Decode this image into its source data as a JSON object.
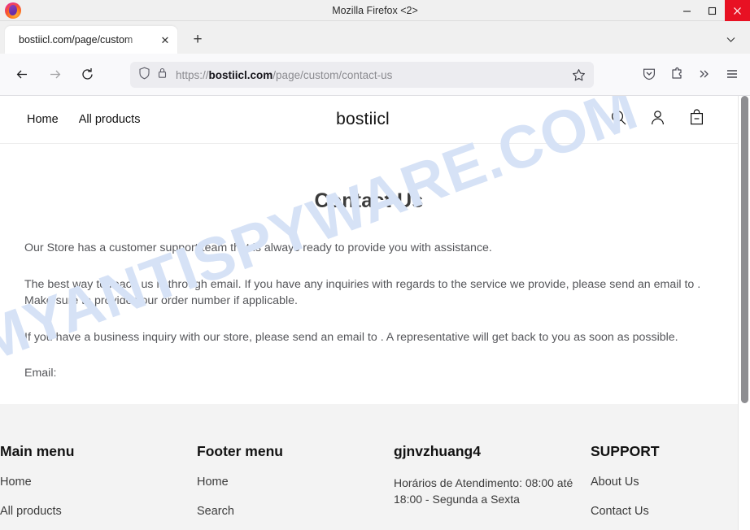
{
  "window": {
    "title": "Mozilla Firefox <2>",
    "controls": {
      "minimize": "minimize-icon",
      "maximize": "maximize-icon",
      "close": "close-icon"
    },
    "logo": "firefox-logo"
  },
  "tabs": {
    "items": [
      {
        "title": "bostiicl.com/page/custom",
        "close_label": "✕"
      }
    ],
    "new_tab_label": "+",
    "list_all_tabs": "chevron-down-icon"
  },
  "toolbar": {
    "back": "back-arrow-icon",
    "forward": "forward-arrow-icon",
    "reload": "reload-icon",
    "shield": "shield-icon",
    "lock": "lock-icon",
    "url_scheme": "https://",
    "url_host": "bostiicl.com",
    "url_path": "/page/custom/contact-us",
    "url_full": "https://bostiicl.com/page/custom/contact-us",
    "bookmark": "star-icon",
    "pocket": "pocket-save-icon",
    "extensions": "extensions-puzzle-icon",
    "overflow": "double-chevron-icon",
    "menu": "hamburger-menu-icon"
  },
  "site": {
    "brand": "bostiicl",
    "nav": [
      {
        "label": "Home"
      },
      {
        "label": "All products"
      }
    ],
    "icons": [
      {
        "name": "search-icon"
      },
      {
        "name": "account-icon"
      },
      {
        "name": "cart-icon"
      }
    ]
  },
  "page": {
    "title": "Contact Us",
    "paragraphs": [
      "Our Store has a customer support team that is always ready to provide you with assistance.",
      "The best way to reach us is through email. If you have any inquiries with regards to the service we provide, please send an email to . Make sure to provide your order number if applicable.",
      "If you have a business inquiry with our store, please send an email to . A representative will get back to you as soon as possible.",
      "Email:"
    ],
    "watermark": "MYANTISPYWARE.COM"
  },
  "footer": {
    "columns": [
      {
        "heading": "Main menu",
        "links": [
          {
            "label": "Home"
          },
          {
            "label": "All products"
          }
        ],
        "text": ""
      },
      {
        "heading": "Footer menu",
        "links": [
          {
            "label": "Home"
          },
          {
            "label": "Search"
          }
        ],
        "text": ""
      },
      {
        "heading": "gjnvzhuang4",
        "links": [],
        "text": "Horários de Atendimento: 08:00 até 18:00 - Segunda a Sexta"
      },
      {
        "heading": "SUPPORT",
        "links": [
          {
            "label": "About Us"
          },
          {
            "label": "Contact Us"
          }
        ],
        "text": ""
      }
    ]
  },
  "colors": {
    "close_button": "#e81123",
    "watermark": "#d6e2f6",
    "footer_bg": "#f3f3f3",
    "chrome_bg": "#f9f9fb"
  }
}
